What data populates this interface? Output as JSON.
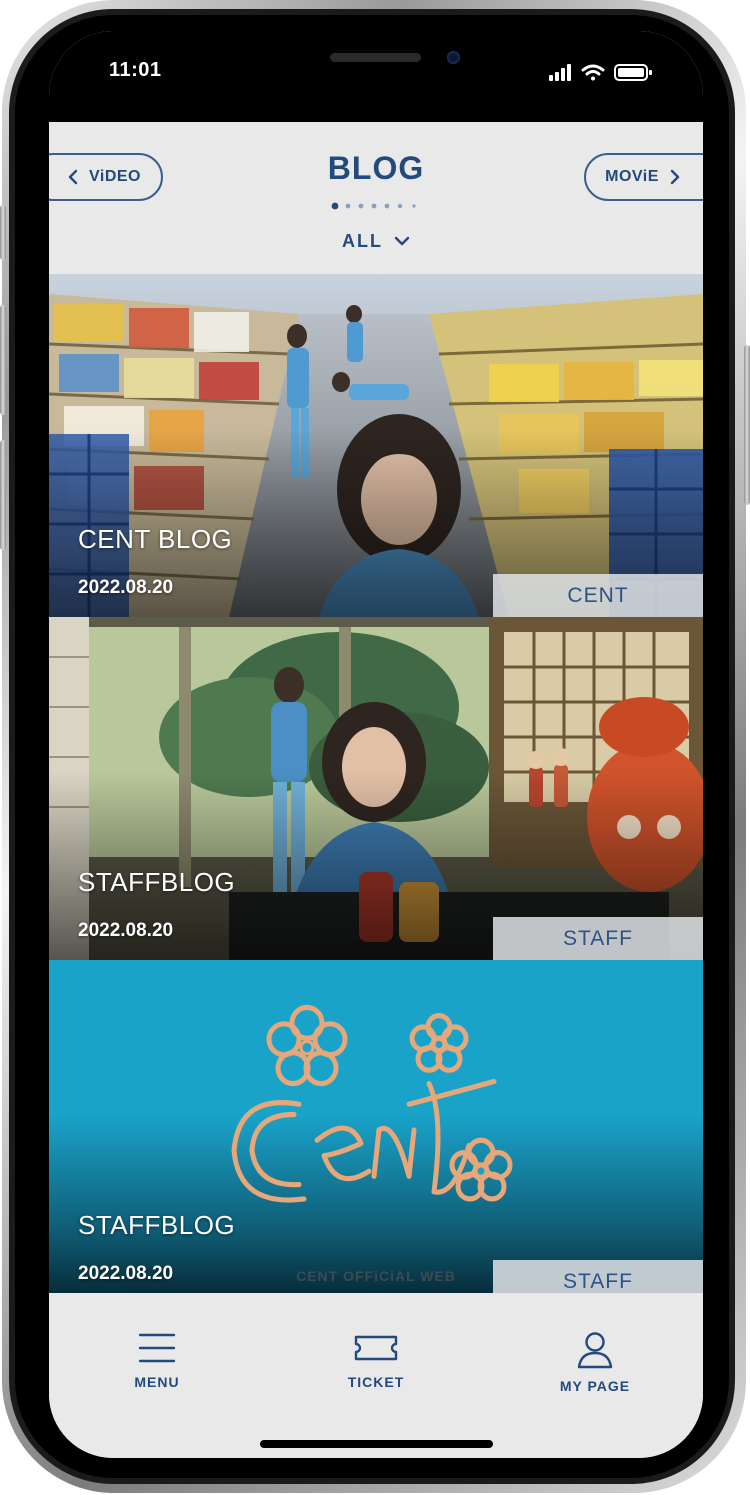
{
  "status_bar": {
    "time": "11:01"
  },
  "header": {
    "title": "BLOG",
    "prev_label": "ViDEO",
    "next_label": "MOViE",
    "filter_label": "ALL",
    "page_dots": 7,
    "active_dot": 0
  },
  "posts": [
    {
      "title": "CENT BLOG",
      "date": "2022.08.20",
      "tag": "CENT"
    },
    {
      "title": "STAFFBLOG",
      "date": "2022.08.20",
      "tag": "STAFF"
    },
    {
      "title": "STAFFBLOG",
      "date": "2022.08.20",
      "tag": "STAFF",
      "watermark": "CENT OFFiCiAL WEB"
    }
  ],
  "tabbar": {
    "menu_label": "MENU",
    "ticket_label": "TICKET",
    "mypage_label": "MY PAGE"
  },
  "colors": {
    "accent": "#234a7c",
    "background": "#e9e9ea",
    "logo_card_teal": "#1aa3c9",
    "logo_outline": "#e6a77a"
  }
}
